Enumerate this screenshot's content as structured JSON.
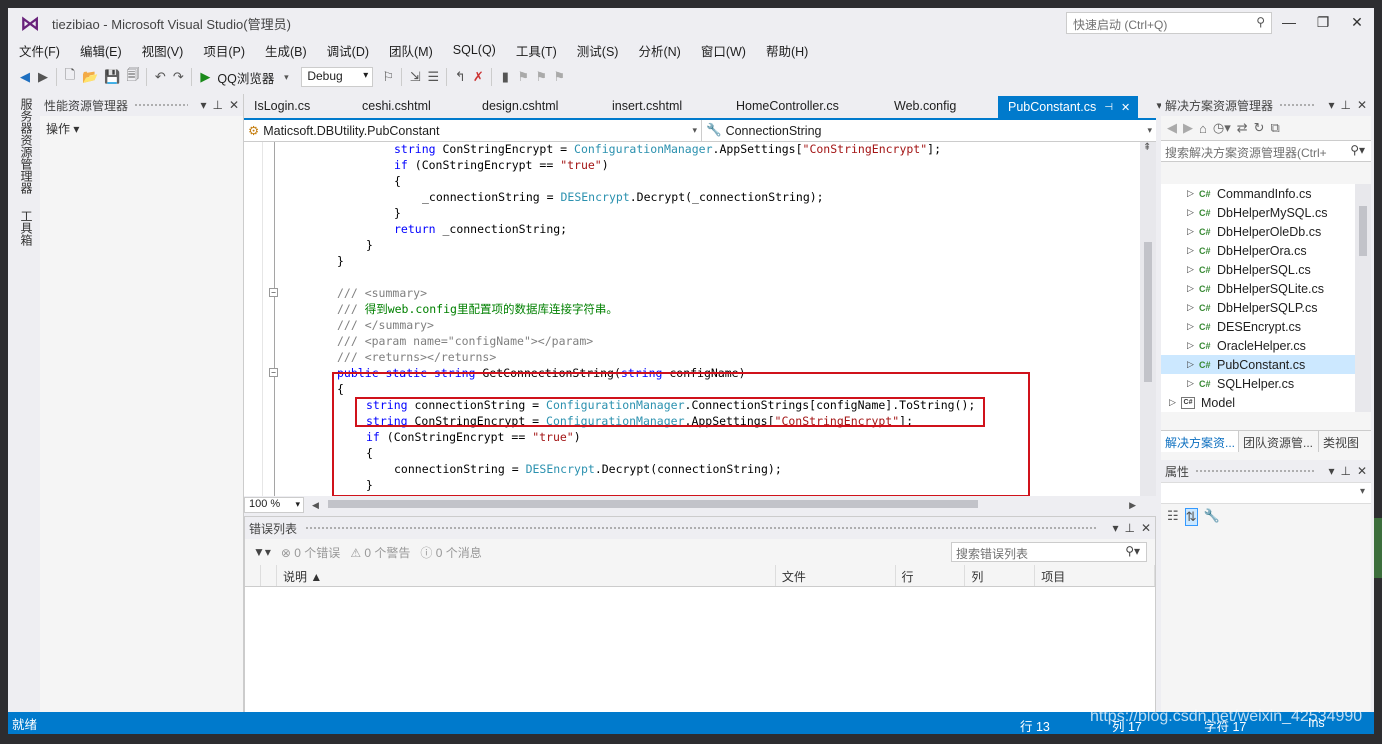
{
  "window": {
    "title": "tiezibiao - Microsoft Visual Studio(管理员)",
    "quick_launch_placeholder": "快速启动 (Ctrl+Q)"
  },
  "menu": [
    "文件(F)",
    "编辑(E)",
    "视图(V)",
    "项目(P)",
    "生成(B)",
    "调试(D)",
    "团队(M)",
    "SQL(Q)",
    "工具(T)",
    "测试(S)",
    "分析(N)",
    "窗口(W)",
    "帮助(H)"
  ],
  "toolbar": {
    "run_label": "QQ浏览器",
    "config": "Debug"
  },
  "left_tabs": [
    "服务器资源管理器",
    "工具箱"
  ],
  "perf_panel": {
    "title": "性能资源管理器",
    "actions": "操作"
  },
  "editor": {
    "tabs": [
      "IsLogin.cs",
      "ceshi.cshtml",
      "design.cshtml",
      "insert.cshtml",
      "HomeController.cs",
      "Web.config",
      "PubConstant.cs"
    ],
    "active_tab": "PubConstant.cs",
    "nav_class": "Maticsoft.DBUtility.PubConstant",
    "nav_member": "ConnectionString",
    "zoom": "100 %",
    "code": {
      "l1_a": "string",
      "l1_b": " ConStringEncrypt = ",
      "l1_c": "ConfigurationManager",
      "l1_d": ".AppSettings[",
      "l1_e": "\"ConStringEncrypt\"",
      "l1_f": "];",
      "l2_a": "if",
      "l2_b": " (ConStringEncrypt == ",
      "l2_c": "\"true\"",
      "l2_d": ")",
      "l3": "{",
      "l4_a": "_connectionString = ",
      "l4_b": "DESEncrypt",
      "l4_c": ".Decrypt(_connectionString);",
      "l5": "}",
      "l6_a": "return",
      "l6_b": " _connectionString;",
      "l7": "}",
      "l8": "}",
      "c1_a": "/// ",
      "c1_b": "<summary>",
      "c2_a": "/// ",
      "c2_b": "得到web.config里配置项的数据库连接字符串。",
      "c3_a": "/// ",
      "c3_b": "</summary>",
      "c4_a": "/// ",
      "c4_b": "<param name=\"configName\"></param>",
      "c5_a": "/// ",
      "c5_b": "<returns></returns>",
      "m1_a": "public static string",
      "m1_b": " GetConnectionString(",
      "m1_c": "string",
      "m1_d": " configName)",
      "m2": "{",
      "m3_a": "string",
      "m3_b": " connectionString = ",
      "m3_c": "ConfigurationManager",
      "m3_d": ".ConnectionStrings[configName].ToString();",
      "m4_a": "string",
      "m4_b": " ConStringEncrypt = ",
      "m4_c": "ConfigurationManager",
      "m4_d": ".AppSettings[",
      "m4_e": "\"ConStringEncrypt\"",
      "m4_f": "];",
      "m5_a": "if",
      "m5_b": " (ConStringEncrypt == ",
      "m5_c": "\"true\"",
      "m5_d": ")",
      "m6": "{",
      "m7_a": "connectionString = ",
      "m7_b": "DESEncrypt",
      "m7_c": ".Decrypt(connectionString);",
      "m8": "}"
    }
  },
  "error_list": {
    "title": "错误列表",
    "errors": "0 个错误",
    "warnings": "0 个警告",
    "messages": "0 个消息",
    "search_placeholder": "搜索错误列表",
    "columns": [
      "说明",
      "文件",
      "行",
      "列",
      "项目"
    ]
  },
  "solution_explorer": {
    "title": "解决方案资源管理器",
    "search_placeholder": "搜索解决方案资源管理器(Ctrl+",
    "files": [
      "CommandInfo.cs",
      "DbHelperMySQL.cs",
      "DbHelperOleDb.cs",
      "DbHelperOra.cs",
      "DbHelperSQL.cs",
      "DbHelperSQLite.cs",
      "DbHelperSQLP.cs",
      "DESEncrypt.cs",
      "OracleHelper.cs",
      "PubConstant.cs",
      "SQLHelper.cs"
    ],
    "selected": "PubConstant.cs",
    "folder": "Model",
    "bottom_tabs": [
      "解决方案资...",
      "团队资源管...",
      "类视图"
    ]
  },
  "properties": {
    "title": "属性"
  },
  "status": {
    "left": "就绪",
    "line": "行 13",
    "col": "列 17",
    "ch": "字符 17",
    "mode": "Ins"
  },
  "watermark": "https://blog.csdn.net/weixin_42534990"
}
